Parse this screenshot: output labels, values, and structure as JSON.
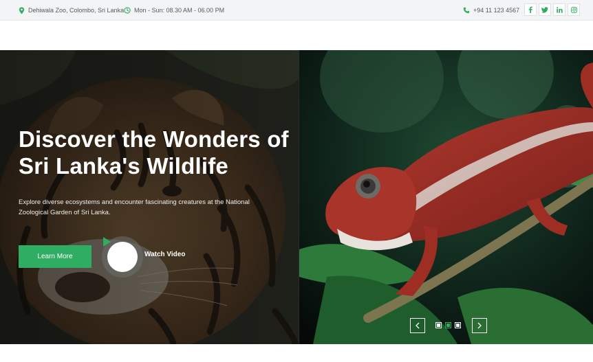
{
  "topbar": {
    "location": "Dehiwala Zoo, Colombo, Sri Lanka",
    "hours": "Mon - Sun: 08.30 AM - 06.00 PM",
    "phone": "+94 11 123 4567",
    "socials": [
      "facebook-icon",
      "twitter-icon",
      "linkedin-icon",
      "instagram-icon"
    ]
  },
  "hero": {
    "title": "Discover the Wonders of Sri Lanka's Wildlife",
    "text": "Explore diverse ecosystems and encounter fascinating creatures at the National Zoological Garden of Sri Lanka.",
    "learn_more": "Learn More",
    "watch_video": "Watch Video",
    "slides": 3,
    "active_slide": 2
  },
  "colors": {
    "accent": "#2fae63",
    "topbar_bg": "#f3f4f5",
    "text_muted": "#55595e"
  }
}
